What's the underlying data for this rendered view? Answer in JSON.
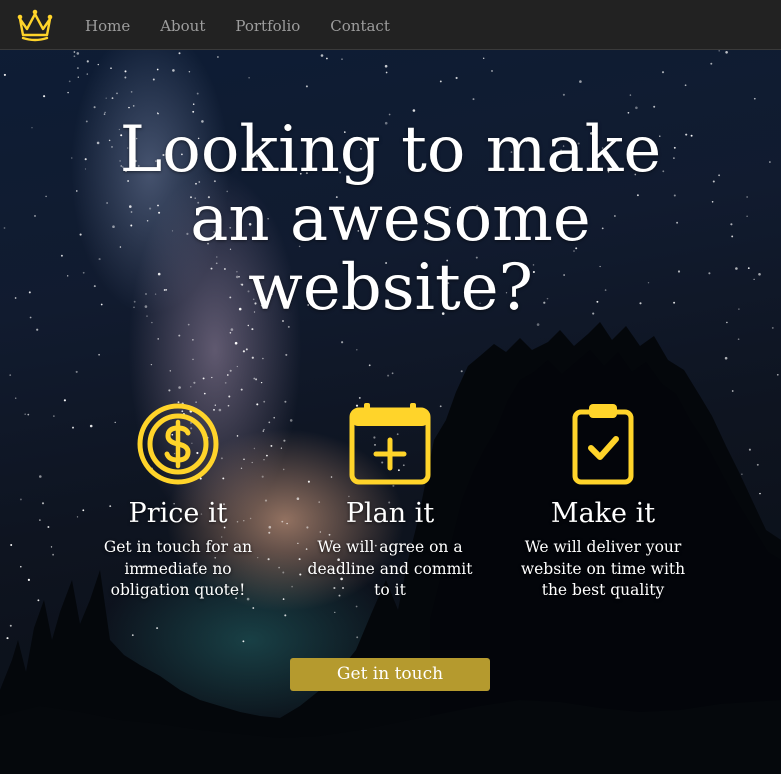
{
  "navbar": {
    "logo_icon": "crown-icon",
    "links": [
      {
        "label": "Home"
      },
      {
        "label": "About"
      },
      {
        "label": "Portfolio"
      },
      {
        "label": "Contact"
      }
    ]
  },
  "hero": {
    "title": "Looking to make an awesome website?"
  },
  "features": [
    {
      "icon": "dollar-coin-icon",
      "title": "Price it",
      "text": "Get in touch for an immediate no obligation quote!"
    },
    {
      "icon": "calendar-plus-icon",
      "title": "Plan it",
      "text": "We will agree on a deadline and commit to it"
    },
    {
      "icon": "clipboard-check-icon",
      "title": "Make it",
      "text": "We will deliver your website on time with the best quality"
    }
  ],
  "cta": {
    "label": "Get in touch"
  },
  "colors": {
    "accent": "#ffd42a",
    "button": "#b59a2e",
    "navbar": "#222222",
    "nav_text": "#9d9d9d"
  }
}
